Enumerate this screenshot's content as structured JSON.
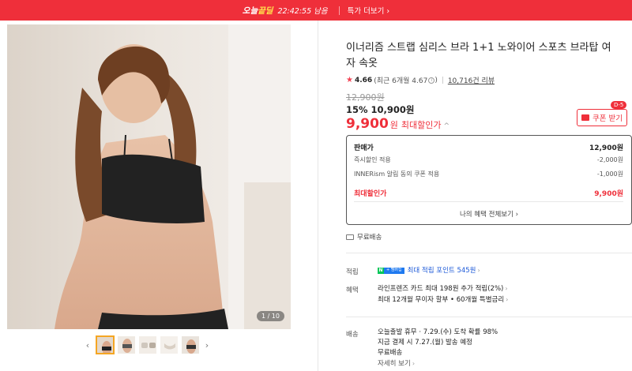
{
  "topbar": {
    "brand_main": "오늘",
    "brand_accent": "끝딜",
    "timer": "22:42:55 남음",
    "link": "특가 더보기",
    "link_chevron": "›"
  },
  "gallery": {
    "counter": "1 / 10",
    "prev_arrow": "‹",
    "next_arrow": "›",
    "thumb_count": 5,
    "active_thumb": 1
  },
  "product": {
    "title": "이너리즘 스트랩 심리스 브라 1+1 노와이어 스포츠 브라탑 여자 속옷",
    "rating": {
      "star": "★",
      "score": "4.66",
      "recent": "(최근 6개월 4.67",
      "recent_close": ")",
      "info": "i",
      "reviews": "10,716건 리뷰"
    },
    "original_price": "12,900원",
    "discount_line": "15% 10,900원",
    "max_price_num": "9,900",
    "max_price_won": "원",
    "max_price_label": "최대할인가",
    "max_price_caret": "^"
  },
  "coupon": {
    "label": "쿠폰 받기",
    "badge": "D-5"
  },
  "price_box": {
    "rows": [
      {
        "k": "판매가",
        "v": "12,900원"
      },
      {
        "k": "즉시할인 적용",
        "v": "-2,000원"
      },
      {
        "k": "INNERism 알림 동의 쿠폰 적용",
        "v": "-1,000원"
      },
      {
        "k": "최대할인가",
        "v": "9,900원"
      }
    ],
    "more": "나의 혜택 전체보기 ›"
  },
  "shipping_badge": "무료배송",
  "points": {
    "label": "적립",
    "n": "N",
    "pay": "+ 멤버십",
    "text": "최대 적립 포인트 545원",
    "chevron": "›"
  },
  "benefits": {
    "label": "혜택",
    "line1": "라인프렌즈 카드 최대 198원 추가 적립(2%)",
    "line2": "최대 12개월 무이자 할부 • 60개월 특별금리",
    "chevron": "›"
  },
  "delivery": {
    "label": "배송",
    "line1": "오늘출발 휴무 · 7.29.(수) 도착 확률 98%",
    "line2": "지금 결제 시 7.27.(월) 발송 예정",
    "line3": "무료배송",
    "line4": "자세히 보기",
    "chevron": "›"
  },
  "colors": {
    "accent": "#ef2f3a",
    "link_blue": "#1c59d8",
    "npay_green": "#03c75a"
  }
}
